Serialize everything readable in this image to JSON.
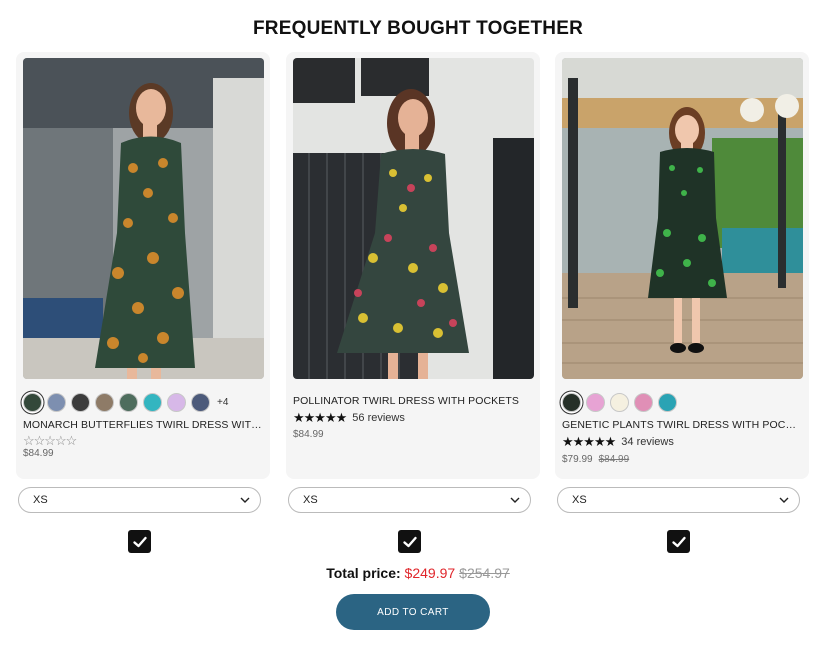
{
  "heading": "FREQUENTLY BOUGHT TOGETHER",
  "products": [
    {
      "title": "MONARCH BUTTERFLIES TWIRL DRESS WITH...",
      "swatch_colors": [
        "#33483a",
        "#7d8fb0",
        "#3c3c3c",
        "#8e7b67",
        "#4e6d5d",
        "#33b5c0",
        "#d7b8e8",
        "#4c5a7a"
      ],
      "more_swatches": "+4",
      "rating_stars": "☆☆☆☆☆",
      "reviews": "",
      "price": "$84.99",
      "old_price": "",
      "size": "XS",
      "dress_color": "#2f4a3a",
      "print_color": "#c9862c"
    },
    {
      "title": "POLLINATOR TWIRL DRESS WITH POCKETS",
      "swatch_colors": [],
      "more_swatches": "",
      "rating_stars": "★★★★★",
      "reviews": "56 reviews",
      "price": "$84.99",
      "old_price": "",
      "size": "XS",
      "dress_color": "#34463f",
      "print_color": "#d9c033"
    },
    {
      "title": "GENETIC PLANTS TWIRL DRESS WITH POCKETS",
      "swatch_colors": [
        "#263028",
        "#e7a3d4",
        "#f5f0e0",
        "#e08fb6",
        "#2aa3b4"
      ],
      "more_swatches": "",
      "rating_stars": "★★★★★",
      "reviews": "34 reviews",
      "price": "$79.99",
      "old_price": "$84.99",
      "size": "XS",
      "dress_color": "#1f3327",
      "print_color": "#3fb34a"
    }
  ],
  "total": {
    "label": "Total price:",
    "price": "$249.97",
    "old_price": "$254.97"
  },
  "add_to_cart_label": "ADD TO CART"
}
